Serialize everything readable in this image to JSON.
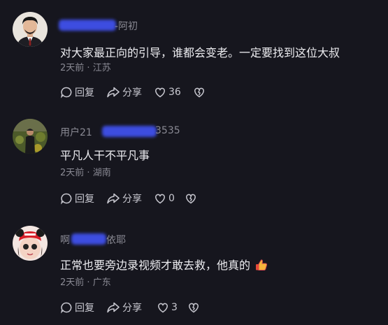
{
  "comments": [
    {
      "username_visible": "-阿初",
      "text": "对大家最正向的引导，谁都会变老。一定要找到这位大叔",
      "time": "2天前",
      "location": "江苏",
      "reply_label": "回复",
      "share_label": "分享",
      "like_count": "36"
    },
    {
      "username_prefix": "用户21",
      "username_suffix": "3535",
      "text": "平凡人干不平凡事",
      "time": "2天前",
      "location": "湖南",
      "reply_label": "回复",
      "share_label": "分享",
      "like_count": "0"
    },
    {
      "username_prefix": "啊",
      "username_suffix": "依耶",
      "text": "正常也要旁边录视频才敢去救，他真的",
      "emoji": "thumbs-up-emoji",
      "time": "2天前",
      "location": "广东",
      "reply_label": "回复",
      "share_label": "分享",
      "like_count": "3"
    }
  ],
  "separator": " · ",
  "colors": {
    "background": "#16161e",
    "text": "#ececf0",
    "muted": "#8a8a94",
    "redaction": "#3d4de0"
  }
}
